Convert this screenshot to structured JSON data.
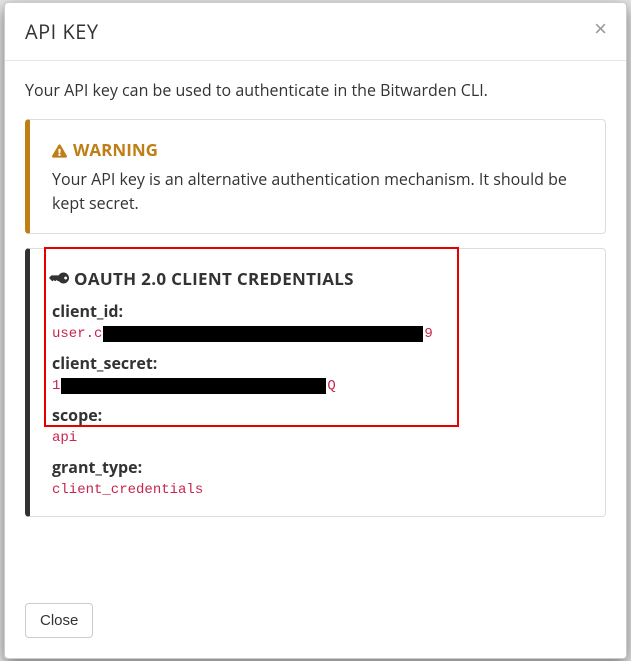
{
  "modal": {
    "title": "API KEY",
    "description": "Your API key can be used to authenticate in the Bitwarden CLI.",
    "close_label": "×"
  },
  "warning": {
    "title": "WARNING",
    "body": "Your API key is an alternative authentication mechanism. It should be kept secret."
  },
  "credentials": {
    "title": "OAUTH 2.0 CLIENT CREDENTIALS",
    "client_id_label": "client_id:",
    "client_id_prefix": "user.c",
    "client_id_suffix": "9",
    "client_secret_label": "client_secret:",
    "client_secret_prefix": "1",
    "client_secret_suffix": "Q",
    "scope_label": "scope:",
    "scope_value": "api",
    "grant_type_label": "grant_type:",
    "grant_type_value": "client_credentials"
  },
  "footer": {
    "close_label": "Close"
  }
}
